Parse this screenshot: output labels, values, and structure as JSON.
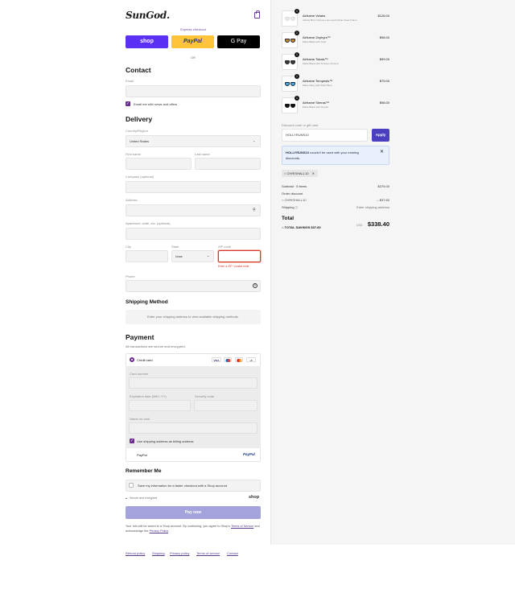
{
  "header": {
    "logo": "SunGod."
  },
  "express": {
    "label": "Express checkout",
    "shop": "shop",
    "paypal": "PayPal",
    "gpay": "G Pay",
    "or": "OR"
  },
  "contact": {
    "title": "Contact",
    "email_label": "Email",
    "email_value": "",
    "newsletter": "Email me with news and offers"
  },
  "delivery": {
    "title": "Delivery",
    "country_label": "Country/Region",
    "country_value": "United States",
    "first_name": "First name",
    "last_name": "Last name",
    "company": "Company (optional)",
    "address": "Address",
    "apartment": "Apartment, suite, etc. (optional)",
    "city": "City",
    "state_label": "State",
    "state_value": "Iowa",
    "zip": "ZIP code",
    "zip_error": "Enter a ZIP / postal code",
    "phone": "Phone"
  },
  "shipping_method": {
    "title": "Shipping Method",
    "message": "Enter your shipping address to view available shipping methods."
  },
  "payment": {
    "title": "Payment",
    "subtitle": "All transactions are secure and encrypted.",
    "credit_card": "Credit card",
    "card_logos": [
      "VISA",
      "",
      "",
      "+5"
    ],
    "card_number": "Card number",
    "expiry": "Expiration date (MM / YY)",
    "security": "Security code",
    "name_on_card": "Name on card",
    "billing_same": "Use shipping address as billing address",
    "paypal": "PayPal",
    "paypal_logo": "PayPal"
  },
  "remember": {
    "title": "Remember Me",
    "save_info": "Save my information for a faster checkout with a Shop account",
    "secure": "Secure and encrypted",
    "shop": "shop"
  },
  "pay_now": "Pay now",
  "terms": {
    "text": "Your info will be saved to a Shop account. By continuing, you agree to Shop's",
    "tos": "Terms of Service",
    "and": "and acknowledge the",
    "privacy": "Privacy Policy",
    "end": "."
  },
  "footer_links": [
    "Refund policy",
    "Shipping",
    "Privacy policy",
    "Terms of service",
    "Contact"
  ],
  "cart": {
    "items": [
      {
        "name": "Airframe Velaris",
        "variant": "Velaris 8KO Chrome Lens and Infinite Clear Frame",
        "price": "$126.00",
        "qty": "1",
        "lens": "#e8e8e8",
        "frame": "#dddddd"
      },
      {
        "name": "Airframe Zephyrs™",
        "variant": "Matte Black with Gold",
        "price": "$98.00",
        "qty": "1",
        "lens": "#c8892f",
        "frame": "#222222"
      },
      {
        "name": "Airframe Tokais™",
        "variant": "Matte Black with Tortoise Chrome",
        "price": "$99.00",
        "qty": "1",
        "lens": "#3a3a3a",
        "frame": "#222222"
      },
      {
        "name": "Airframe Tempests™",
        "variant": "Matte Navy with Silver Blue",
        "price": "$79.00",
        "qty": "1",
        "lens": "#3fa9d6",
        "frame": "#1d2b4a"
      },
      {
        "name": "Airframe Sierras™",
        "variant": "Matte Black with Smoke",
        "price": "$98.00",
        "qty": "1",
        "lens": "#111111",
        "frame": "#111111"
      }
    ],
    "discount_placeholder": "Discount code or gift card",
    "discount_value": "HOLLYRUNS10",
    "apply": "Apply",
    "alert_code": "HOLLYRUNS10",
    "alert_text": "couldn't be used with your existing discounts.",
    "applied_code": "CHRISHALL10",
    "subtotal_label": "Subtotal · 5 items",
    "subtotal_value": "$376.00",
    "order_discount_label": "Order discount",
    "discount_code_label": "CHRISHALL10",
    "discount_amount": "– $37.60",
    "shipping_label": "Shipping",
    "shipping_value": "Enter shipping address",
    "total_label": "Total",
    "total_currency": "USD",
    "total_value": "$338.40",
    "savings_label": "TOTAL SAVINGS",
    "savings_value": "$37.60"
  }
}
